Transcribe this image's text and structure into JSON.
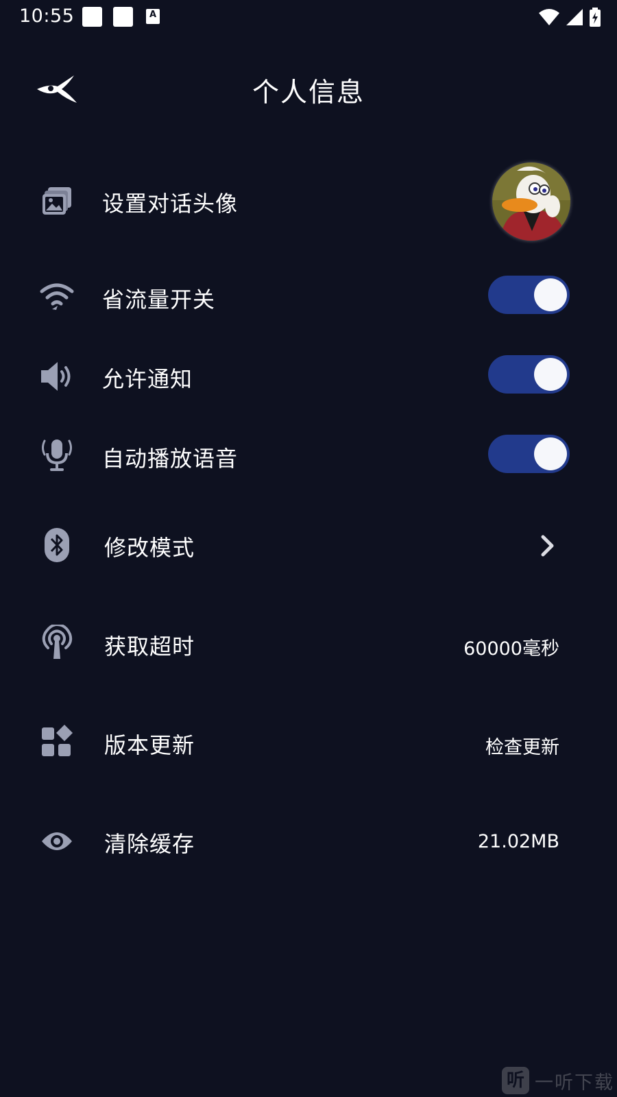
{
  "status_bar": {
    "time": "10:55"
  },
  "header": {
    "title": "个人信息"
  },
  "settings": {
    "avatar": {
      "label": "设置对话头像"
    },
    "data_saver": {
      "label": "省流量开关",
      "enabled": true
    },
    "notifications": {
      "label": "允许通知",
      "enabled": true
    },
    "autoplay_voice": {
      "label": "自动播放语音",
      "enabled": true
    },
    "mode": {
      "label": "修改模式"
    },
    "timeout": {
      "label": "获取超时",
      "value": "60000毫秒"
    },
    "update": {
      "label": "版本更新",
      "value": "检查更新"
    },
    "cache": {
      "label": "清除缓存",
      "value": "21.02MB"
    }
  },
  "colors": {
    "background": "#0e1120",
    "toggle_on": "#223a8c",
    "icon": "#9ba0b4"
  },
  "watermark": {
    "text": "一听下载"
  }
}
